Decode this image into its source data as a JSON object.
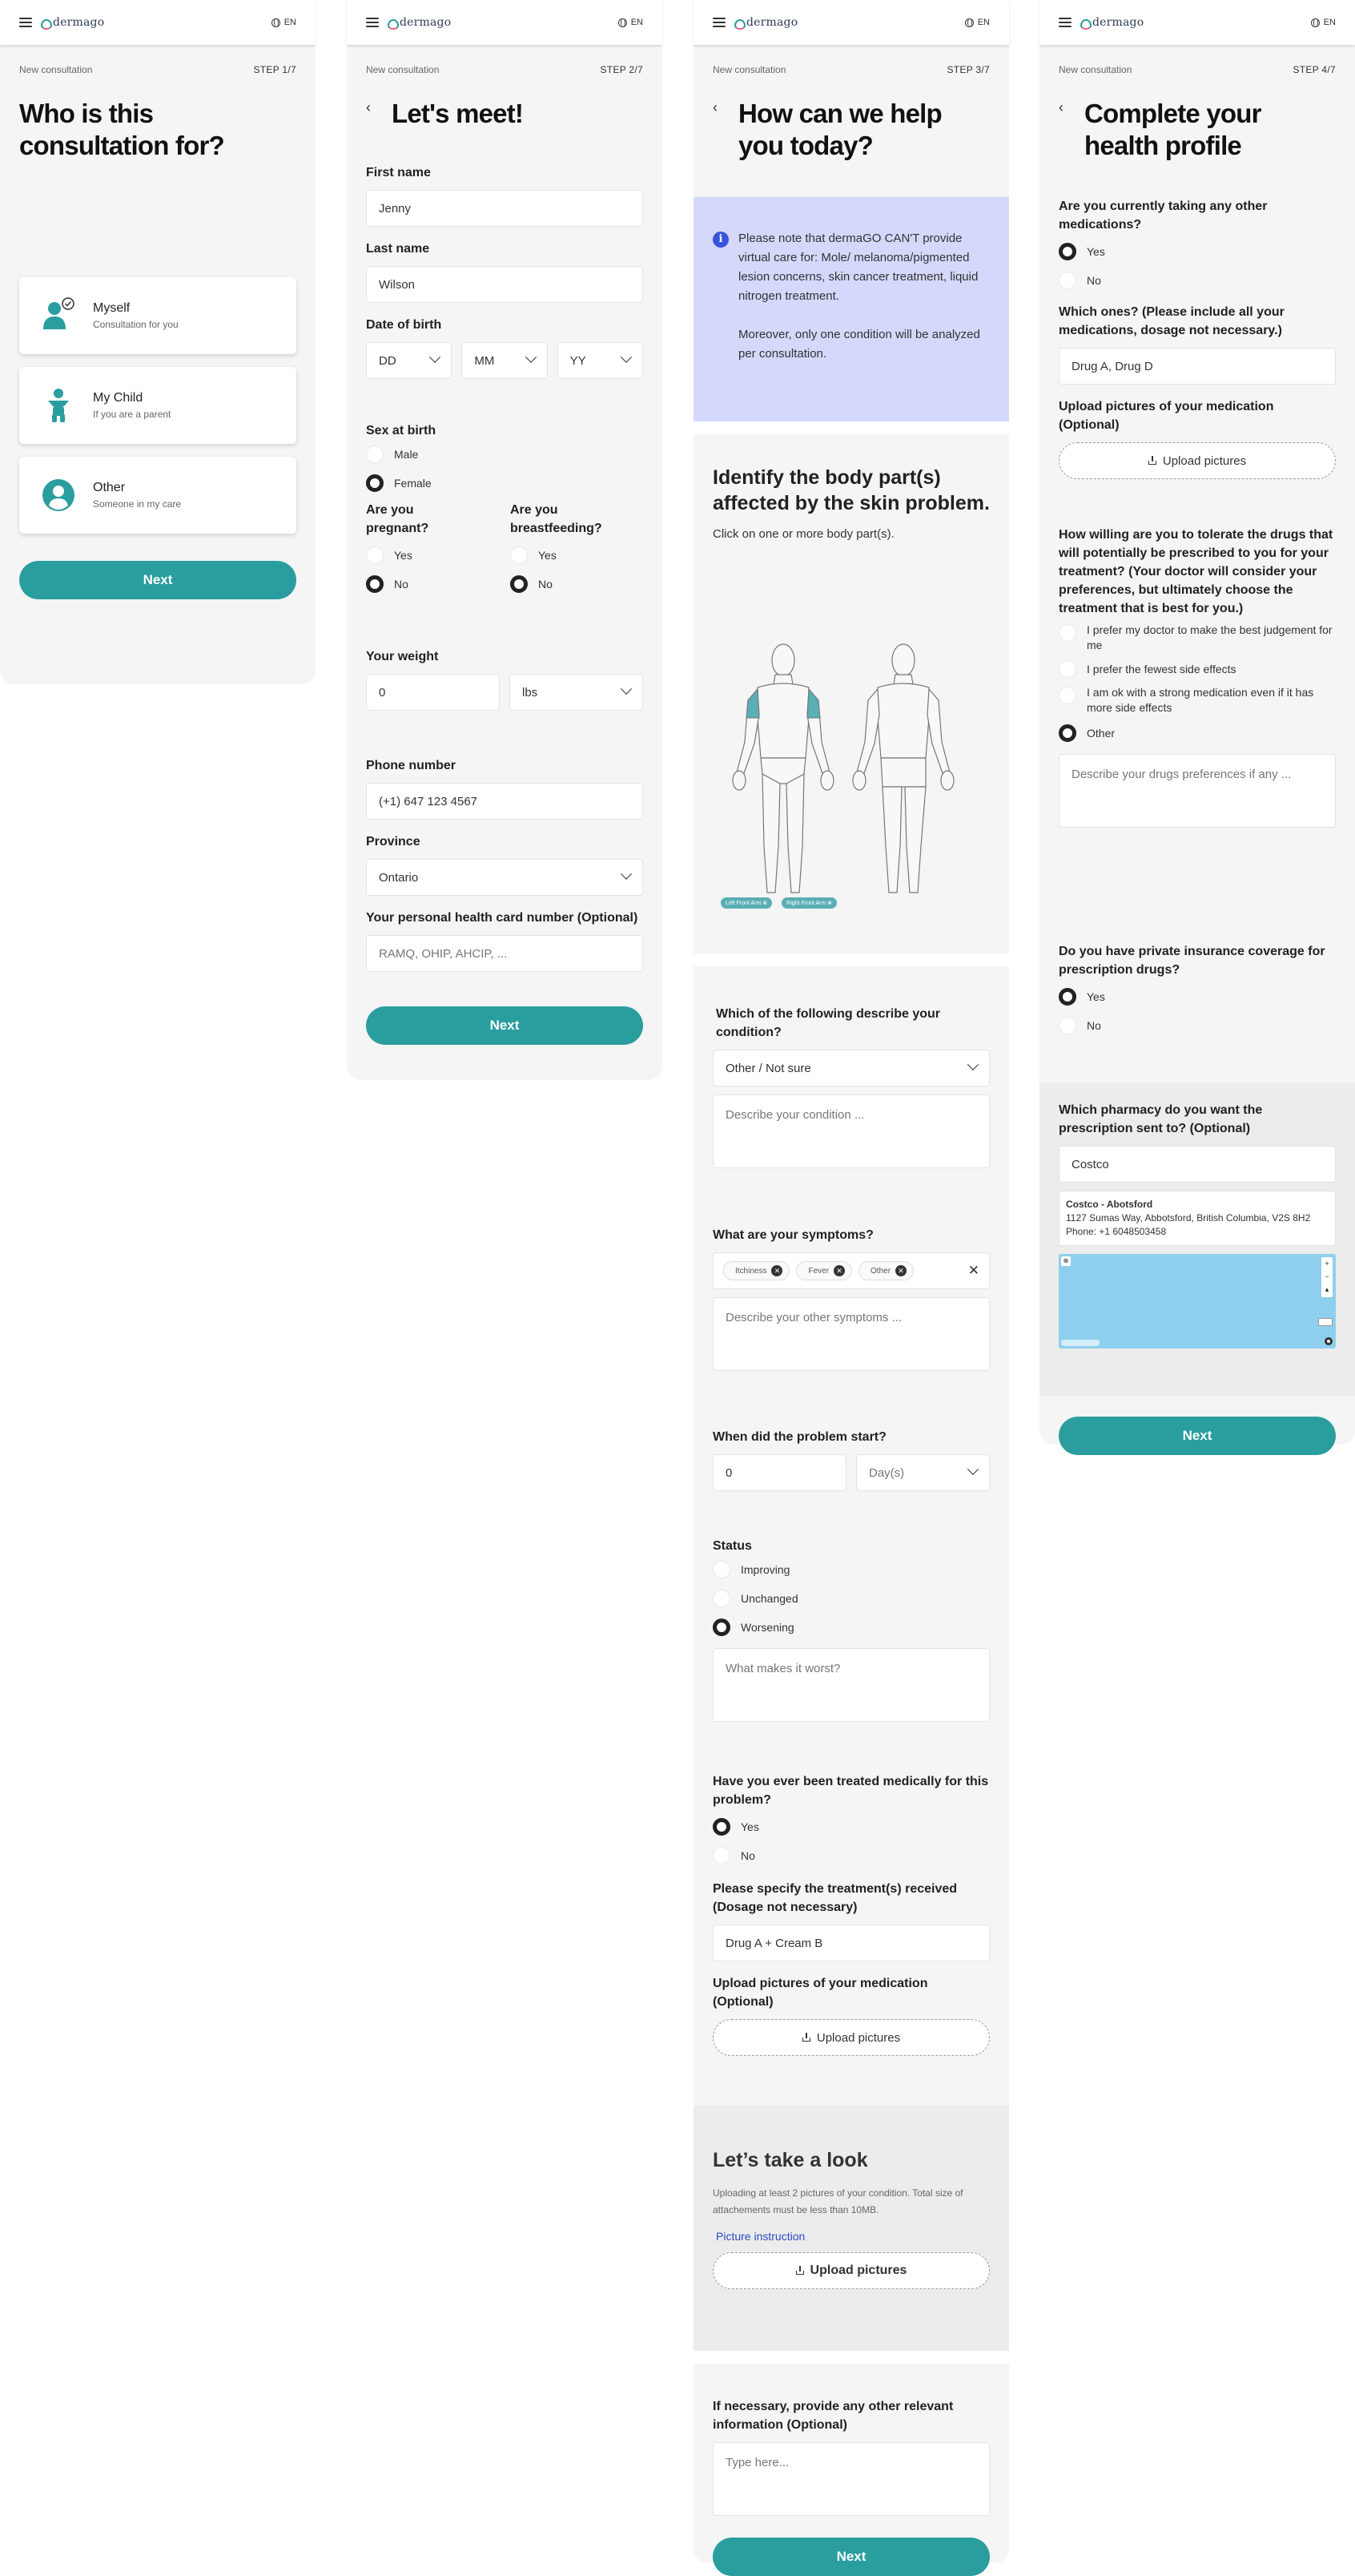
{
  "brand": {
    "name": "dermago",
    "lang": "EN"
  },
  "common": {
    "new_consultation": "New consultation",
    "next": "Next",
    "upload_pictures": "Upload pictures",
    "yes": "Yes",
    "no": "No"
  },
  "s1": {
    "step": "STEP 1/7",
    "title": "Who is this consultation for?",
    "options": [
      {
        "title": "Myself",
        "sub": "Consultation for you"
      },
      {
        "title": "My Child",
        "sub": "If you are a parent"
      },
      {
        "title": "Other",
        "sub": "Someone in my care"
      }
    ]
  },
  "s2": {
    "step": "STEP 2/7",
    "title": "Let's meet!",
    "first_name_label": "First name",
    "first_name": "Jenny",
    "last_name_label": "Last name",
    "last_name": "Wilson",
    "dob_label": "Date of birth",
    "dob_dd": "DD",
    "dob_mm": "MM",
    "dob_yy": "YY",
    "sex_label": "Sex at birth",
    "male": "Male",
    "female": "Female",
    "pregnant_label": "Are you pregnant?",
    "breastfeeding_label": "Are you breastfeeding?",
    "weight_label": "Your weight",
    "weight": "0",
    "weight_unit": "lbs",
    "phone_label": "Phone number",
    "phone": "(+1) 647 123 4567",
    "province_label": "Province",
    "province": "Ontario",
    "health_card_label": "Your personal health card number (Optional)",
    "health_card_placeholder": "RAMQ, OHIP, AHCIP, ..."
  },
  "s3": {
    "step": "STEP 3/7",
    "title": "How can we help you today?",
    "notice_1": "Please note that dermaGO CAN'T provide virtual care for: Mole/ melanoma/pigmented lesion concerns, skin cancer treatment, liquid nitrogen treatment.",
    "notice_2": "Moreover, only one condition will be analyzed per consultation.",
    "body_title": "Identify the body part(s) affected by the skin problem.",
    "body_sub": "Click on one or more body part(s).",
    "tag_left": "Left Front Arm",
    "tag_right": "Right Front Arm",
    "condition_label": "Which of the following describe your condition?",
    "condition": "Other / Not sure",
    "condition_placeholder": "Describe your condition ...",
    "symptoms_label": "What are your symptoms?",
    "symptoms": [
      "Itchiness",
      "Fever",
      "Other"
    ],
    "symptoms_placeholder": "Describe your other symptoms ...",
    "start_label": "When did the problem start?",
    "start_value": "0",
    "start_unit": "Day(s)",
    "status_label": "Status",
    "status_options": [
      "Improving",
      "Unchanged",
      "Worsening"
    ],
    "status_placeholder": "What makes it worst?",
    "treated_label": "Have you ever been treated medically for this problem?",
    "treatment_label": "Please specify the treatment(s) received (Dosage not necessary)",
    "treatment": "Drug A + Cream B",
    "upload_med_label": "Upload pictures of your medication (Optional)",
    "look_title": "Let’s take a look",
    "look_text": "Uploading at least 2 pictures of your condition. Total size of attachements must be less than 10MB.",
    "picture_instruction": "Picture instruction",
    "other_info_label": "If necessary, provide any other relevant information (Optional)",
    "other_info_placeholder": "Type here..."
  },
  "s4": {
    "step": "STEP 4/7",
    "title": "Complete your health profile",
    "meds_label": "Are you currently taking any other medications?",
    "which_label": "Which ones? (Please include all your medications, dosage not necessary.)",
    "which_value": "Drug A, Drug D",
    "upload_med_label": "Upload pictures of your medication (Optional)",
    "tolerate_label": "How willing are you to tolerate the drugs that will potentially be prescribed to you for your treatment? (Your doctor will consider your preferences, but ultimately choose the treatment that is best for you.)",
    "tolerate_options": [
      "I prefer my doctor to make the best judgement for me",
      "I prefer the fewest side effects",
      "I am ok with a strong medication even if it has more side effects",
      "Other"
    ],
    "tolerate_placeholder": "Describe your drugs preferences if any ...",
    "insurance_label": "Do you have private insurance coverage for prescription drugs?",
    "pharmacy_label": "Which pharmacy do you want the prescription sent to? (Optional)",
    "pharmacy_value": "Costco",
    "pharmacy_name": "Costco - Abotsford",
    "pharmacy_addr": "1127 Sumas Way, Abbotsford, British Columbia, V2S 8H2",
    "pharmacy_phone": "Phone: +1 6048503458"
  },
  "colors": {
    "teal": "#2a9d9f",
    "notice_bg": "#d4d8fb",
    "info_blue": "#3a55d9",
    "map": "#8fcfee"
  }
}
